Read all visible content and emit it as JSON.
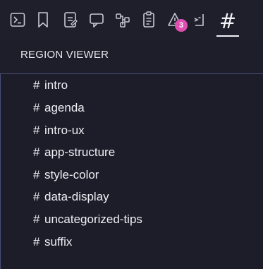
{
  "toolbar": {
    "icons": [
      {
        "name": "terminal-icon"
      },
      {
        "name": "bookmark-icon"
      },
      {
        "name": "document-edit-icon"
      },
      {
        "name": "comment-icon"
      },
      {
        "name": "structure-icon"
      },
      {
        "name": "clipboard-icon"
      },
      {
        "name": "warning-icon"
      },
      {
        "name": "code-icon"
      },
      {
        "name": "hash-icon"
      }
    ],
    "warning_badge": "3",
    "active_tab_glyph": "#"
  },
  "panel": {
    "title": "REGION VIEWER",
    "hash_symbol": "#",
    "regions": [
      "intro",
      "agenda",
      "intro-ux",
      "app-structure",
      "style-color",
      "data-display",
      "uncategorized-tips",
      "suffix"
    ]
  },
  "colors": {
    "background": "#1e1e2a",
    "badge": "#e04fb0",
    "divider": "#4a4e7a",
    "text": "#eeeef5"
  }
}
